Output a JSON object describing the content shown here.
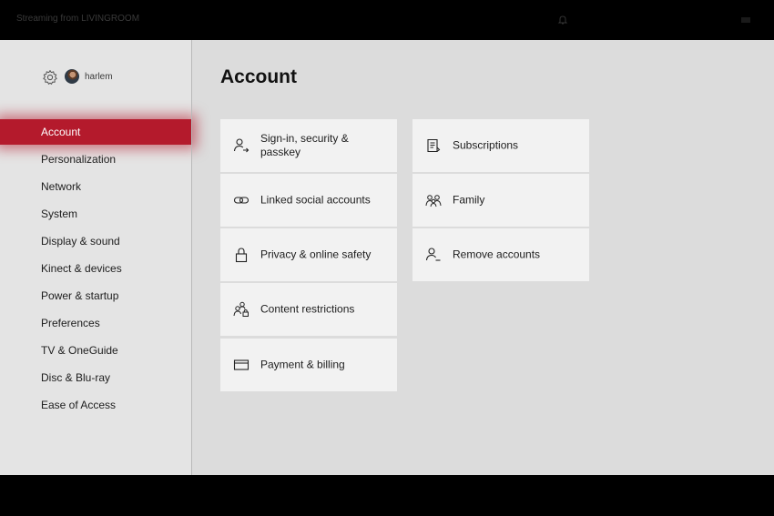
{
  "topbar": {
    "title": "Streaming from LIVINGROOM"
  },
  "profile": {
    "username": "harlem"
  },
  "sidebar": {
    "items": [
      {
        "label": "Account",
        "active": true
      },
      {
        "label": "Personalization"
      },
      {
        "label": "Network"
      },
      {
        "label": "System"
      },
      {
        "label": "Display & sound"
      },
      {
        "label": "Kinect & devices"
      },
      {
        "label": "Power & startup"
      },
      {
        "label": "Preferences"
      },
      {
        "label": "TV & OneGuide"
      },
      {
        "label": "Disc & Blu-ray"
      },
      {
        "label": "Ease of Access"
      }
    ]
  },
  "main": {
    "title": "Account",
    "tiles": [
      {
        "label": "Sign-in, security & passkey",
        "icon": "person-arrow-icon"
      },
      {
        "label": "Linked social accounts",
        "icon": "link-icon"
      },
      {
        "label": "Privacy & online safety",
        "icon": "lock-icon"
      },
      {
        "label": "Content restrictions",
        "icon": "people-lock-icon"
      },
      {
        "label": "Payment & billing",
        "icon": "credit-card-icon"
      },
      {
        "label": "Subscriptions",
        "icon": "subscriptions-icon"
      },
      {
        "label": "Family",
        "icon": "family-icon"
      },
      {
        "label": "Remove accounts",
        "icon": "person-remove-icon"
      }
    ]
  },
  "colors": {
    "accent": "#b41a2c",
    "tile": "#f2f2f2",
    "background": "#dcdcdc"
  }
}
